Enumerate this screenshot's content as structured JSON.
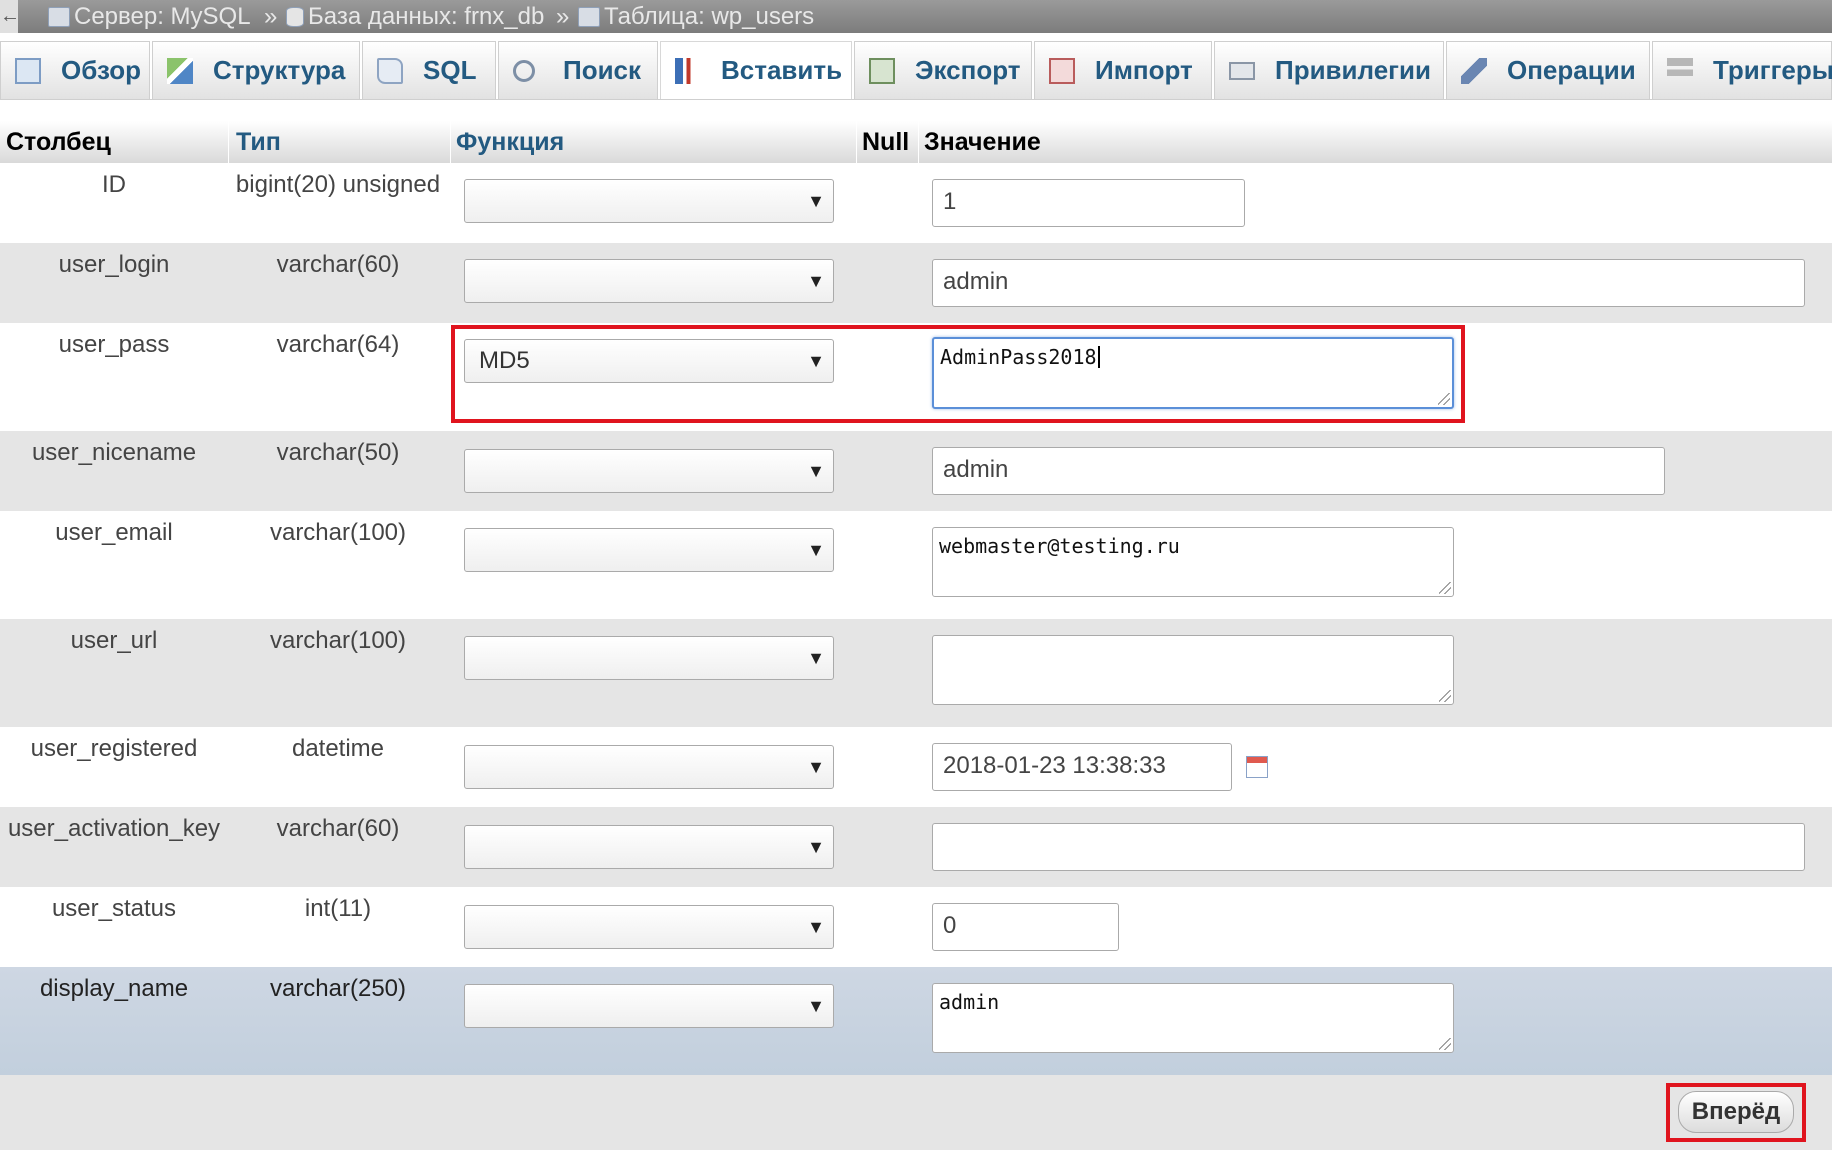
{
  "breadcrumb": {
    "server": "Сервер: MySQL",
    "database": "База данных: frnx_db",
    "table": "Таблица: wp_users",
    "separator": "»"
  },
  "tabs": [
    {
      "label": "Обзор",
      "icon": "browse-icon"
    },
    {
      "label": "Структура",
      "icon": "structure-icon"
    },
    {
      "label": "SQL",
      "icon": "sql-icon"
    },
    {
      "label": "Поиск",
      "icon": "search-icon"
    },
    {
      "label": "Вставить",
      "icon": "insert-icon",
      "active": true
    },
    {
      "label": "Экспорт",
      "icon": "export-icon"
    },
    {
      "label": "Импорт",
      "icon": "import-icon"
    },
    {
      "label": "Привилегии",
      "icon": "privileges-icon"
    },
    {
      "label": "Операции",
      "icon": "operations-icon"
    },
    {
      "label": "Триггеры",
      "icon": "triggers-icon"
    }
  ],
  "table_header": {
    "column": "Столбец",
    "type": "Тип",
    "function": "Функция",
    "null": "Null",
    "value": "Значение"
  },
  "rows": [
    {
      "name": "ID",
      "type": "bigint(20) unsigned",
      "function": "",
      "value": "1"
    },
    {
      "name": "user_login",
      "type": "varchar(60)",
      "function": "",
      "value": "admin"
    },
    {
      "name": "user_pass",
      "type": "varchar(64)",
      "function": "MD5",
      "value": "AdminPass2018"
    },
    {
      "name": "user_nicename",
      "type": "varchar(50)",
      "function": "",
      "value": "admin"
    },
    {
      "name": "user_email",
      "type": "varchar(100)",
      "function": "",
      "value": "webmaster@testing.ru"
    },
    {
      "name": "user_url",
      "type": "varchar(100)",
      "function": "",
      "value": ""
    },
    {
      "name": "user_registered",
      "type": "datetime",
      "function": "",
      "value": "2018-01-23 13:38:33"
    },
    {
      "name": "user_activation_key",
      "type": "varchar(60)",
      "function": "",
      "value": ""
    },
    {
      "name": "user_status",
      "type": "int(11)",
      "function": "",
      "value": "0"
    },
    {
      "name": "display_name",
      "type": "varchar(250)",
      "function": "",
      "value": "admin"
    }
  ],
  "select_arrow": "▼",
  "back_arrow": "←",
  "go_button": "Вперёд",
  "colors": {
    "highlight_red": "#e0141e",
    "link_blue": "#235a81",
    "row_alt": "#e5e5e5",
    "row_highlight": "#c6d2e0"
  }
}
